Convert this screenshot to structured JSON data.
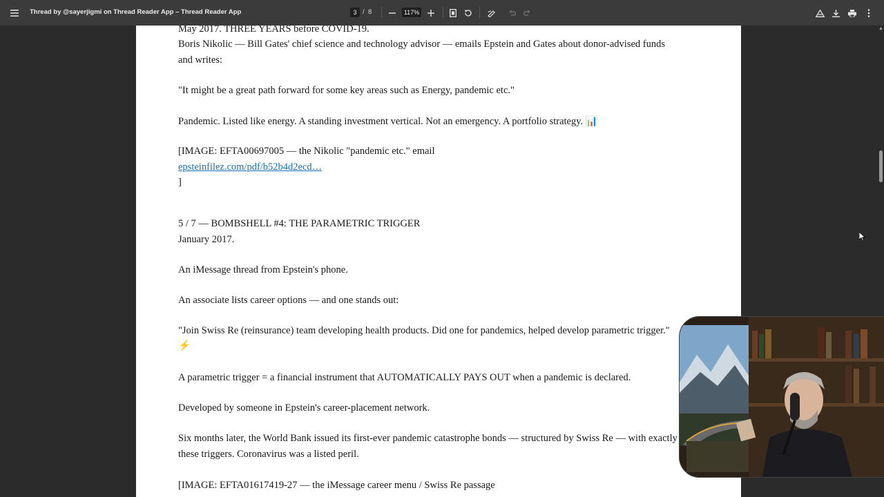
{
  "toolbar": {
    "title": "Thread by @sayerjigmi on Thread Reader App – Thread Reader App",
    "page_current": "3",
    "page_separator": "/",
    "page_total": "8",
    "zoom": "117%",
    "icons": [
      "menu-icon",
      "zoom-out-icon",
      "zoom-in-icon",
      "fit-page-icon",
      "rotate-icon",
      "draw-icon",
      "undo-icon",
      "redo-icon",
      "drive-icon",
      "download-icon",
      "print-icon",
      "more-icon"
    ]
  },
  "document": {
    "lines": [
      "May 2017. THREE YEARS before COVID-19.",
      "Boris Nikolic — Bill Gates' chief science and technology advisor — emails Epstein and Gates about donor-advised funds",
      "and writes:",
      "\"It might be a great path forward for some key areas such as Energy, pandemic etc.\"",
      "Pandemic. Listed like energy. A standing investment vertical. Not an emergency. A portfolio strategy. 📊",
      "[IMAGE: EFTA00697005 — the Nikolic \"pandemic etc.\" email",
      "epsteinfilez.com/pdf/b52b4d2ecd…",
      "]",
      "5 / 7 — BOMBSHELL #4: THE PARAMETRIC TRIGGER",
      "January 2017.",
      "An iMessage thread from Epstein's phone.",
      "An associate lists career options — and one stands out:",
      "\"Join Swiss Re (reinsurance) team developing health products. Did one for pandemics, helped develop parametric trigger.\"",
      "⚡",
      "A parametric trigger = a financial instrument that AUTOMATICALLY PAYS OUT when a pandemic is declared.",
      "Developed by someone in Epstein's career-placement network.",
      "Six months later, the World Bank issued its first-ever pandemic catastrophe bonds — structured by Swiss Re — with exactly",
      "these triggers. Coronavirus was a listed peril.",
      "[IMAGE: EFTA01617419-27 — the iMessage career menu / Swiss Re passage"
    ]
  },
  "colors": {
    "toolbar_bg": "#3b3b3b",
    "viewer_bg": "#2b2b2b",
    "page_bg": "#ffffff",
    "link": "#1a6fb5"
  }
}
